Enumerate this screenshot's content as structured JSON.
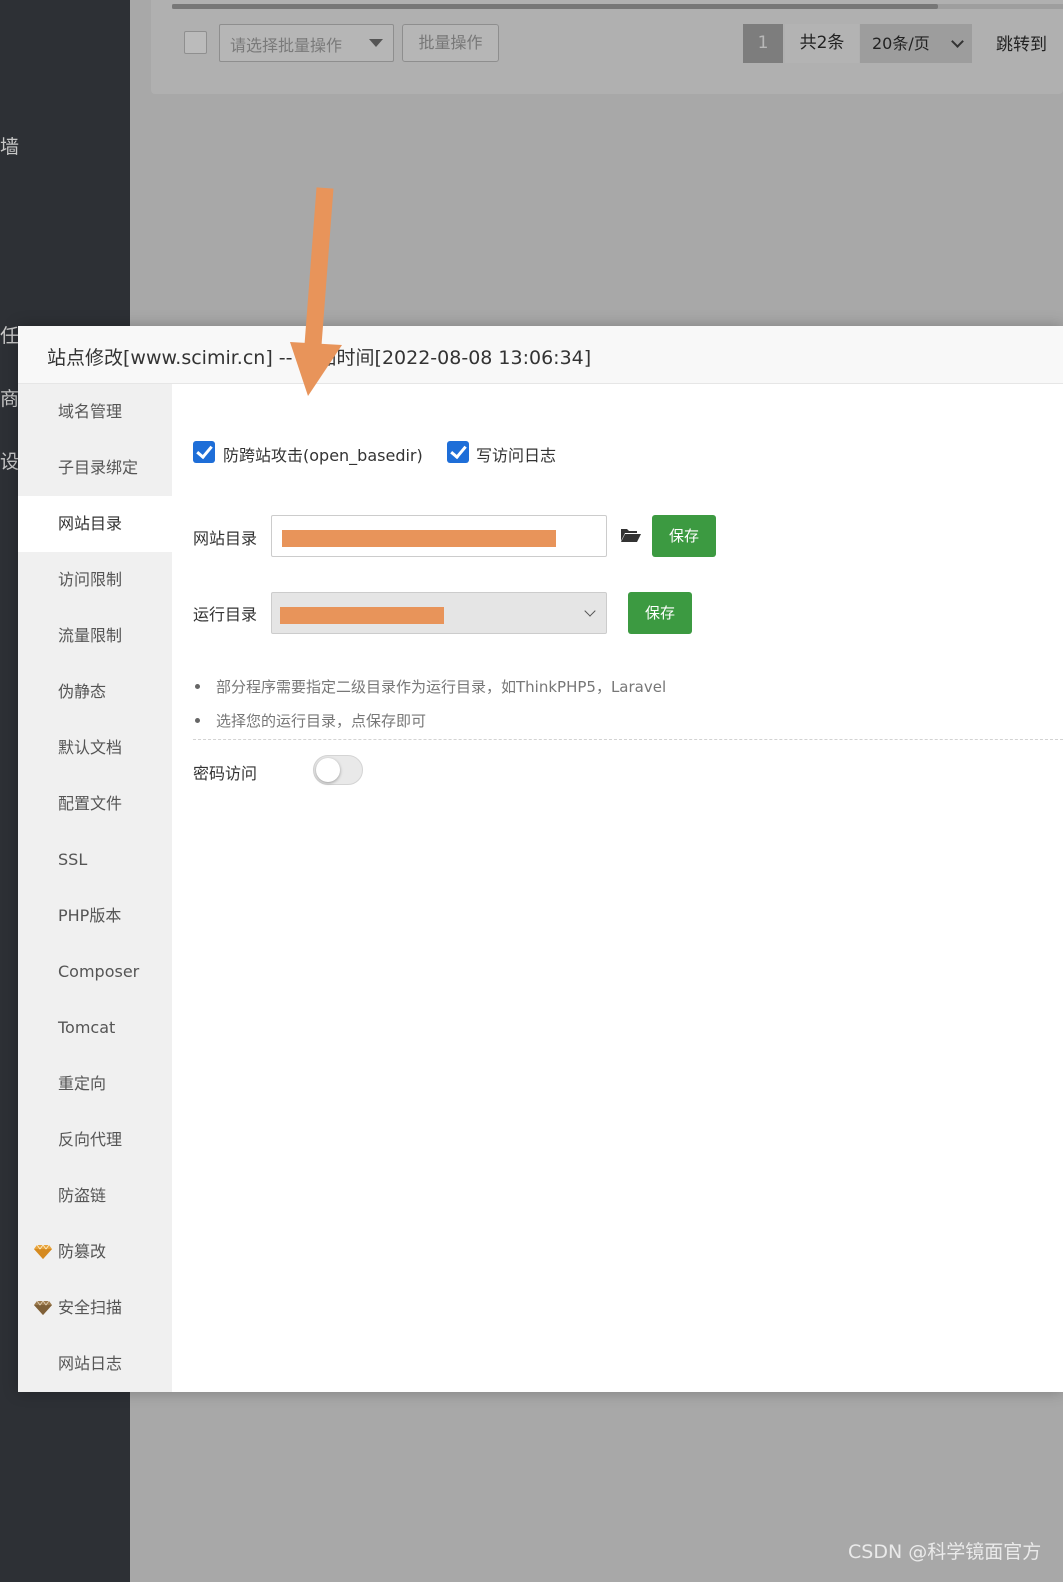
{
  "app_sidebar": {
    "fragments": [
      "墙",
      "任务",
      "商店",
      "设置"
    ]
  },
  "table_toolbar": {
    "batch_select_placeholder": "请选择批量操作",
    "batch_button": "批量操作",
    "current_page": "1",
    "total": "共2条",
    "page_size": "20条/页",
    "jump_label": "跳转到"
  },
  "modal": {
    "title": "站点修改[www.scimir.cn] -- 添加时间[2022-08-08 13:06:34]",
    "tabs": [
      {
        "label": "域名管理"
      },
      {
        "label": "子目录绑定"
      },
      {
        "label": "网站目录",
        "active": true
      },
      {
        "label": "访问限制"
      },
      {
        "label": "流量限制"
      },
      {
        "label": "伪静态"
      },
      {
        "label": "默认文档"
      },
      {
        "label": "配置文件"
      },
      {
        "label": "SSL"
      },
      {
        "label": "PHP版本"
      },
      {
        "label": "Composer"
      },
      {
        "label": "Tomcat"
      },
      {
        "label": "重定向"
      },
      {
        "label": "反向代理"
      },
      {
        "label": "防盗链"
      },
      {
        "label": "防篡改",
        "icon": "gem-icon",
        "icon_color": "#e8a33b"
      },
      {
        "label": "安全扫描",
        "icon": "gem-icon",
        "icon_color": "#9c7a4d"
      },
      {
        "label": "网站日志"
      }
    ],
    "content": {
      "checkbox_open_basedir": "防跨站攻击(open_basedir)",
      "checkbox_access_log": "写访问日志",
      "site_dir_label": "网站目录",
      "run_dir_label": "运行目录",
      "save_label": "保存",
      "tips": [
        "部分程序需要指定二级目录作为运行目录，如ThinkPHP5，Laravel",
        "选择您的运行目录，点保存即可"
      ],
      "password_access_label": "密码访问"
    }
  },
  "watermark": "CSDN @科学镜面官方",
  "colors": {
    "accent_green": "#3c9a41",
    "checkbox_blue": "#1e6ed8",
    "annotation_orange": "#e8945a"
  }
}
